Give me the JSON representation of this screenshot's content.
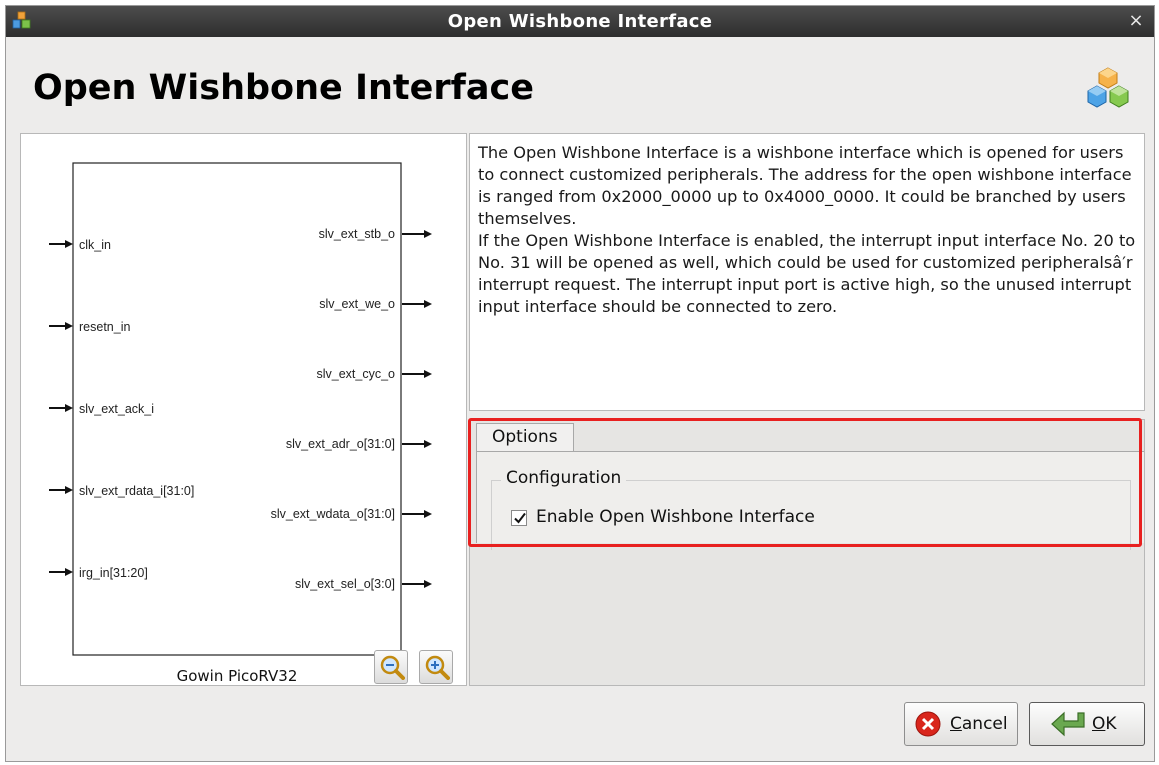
{
  "window": {
    "title": "Open Wishbone Interface",
    "close_glyph": "×"
  },
  "header": {
    "title": "Open Wishbone Interface",
    "logo_icon": "cubes-logo-icon"
  },
  "diagram": {
    "block_name": "Gowin PicoRV32",
    "inputs": [
      "clk_in",
      "resetn_in",
      "slv_ext_ack_i",
      "slv_ext_rdata_i[31:0]",
      "irg_in[31:20]"
    ],
    "outputs": [
      "slv_ext_stb_o",
      "slv_ext_we_o",
      "slv_ext_cyc_o",
      "slv_ext_adr_o[31:0]",
      "slv_ext_wdata_o[31:0]",
      "slv_ext_sel_o[3:0]"
    ],
    "zoom_out_icon": "zoom-out-icon",
    "zoom_in_icon": "zoom-in-icon"
  },
  "description": {
    "paragraph1": "The Open Wishbone Interface is a wishbone interface which is opened for users to connect customized peripherals. The address for the open wishbone interface is ranged from 0x2000_0000 up to 0x4000_0000. It could be branched by users themselves.",
    "paragraph2": "If the Open Wishbone Interface is enabled, the interrupt input interface No. 20 to No. 31 will be opened as well, which could be used for customized peripheralsâ′r interrupt request. The interrupt input port is active high, so the unused interrupt input interface should be connected to zero."
  },
  "options": {
    "tab_label": "Options",
    "group_title": "Configuration",
    "enable_label": "Enable Open Wishbone Interface",
    "enable_checked": true
  },
  "buttons": {
    "cancel_label": "Cancel",
    "ok_label": "OK"
  },
  "colors": {
    "highlight": "#e8201f",
    "titlebar": "#3a3a3a"
  }
}
